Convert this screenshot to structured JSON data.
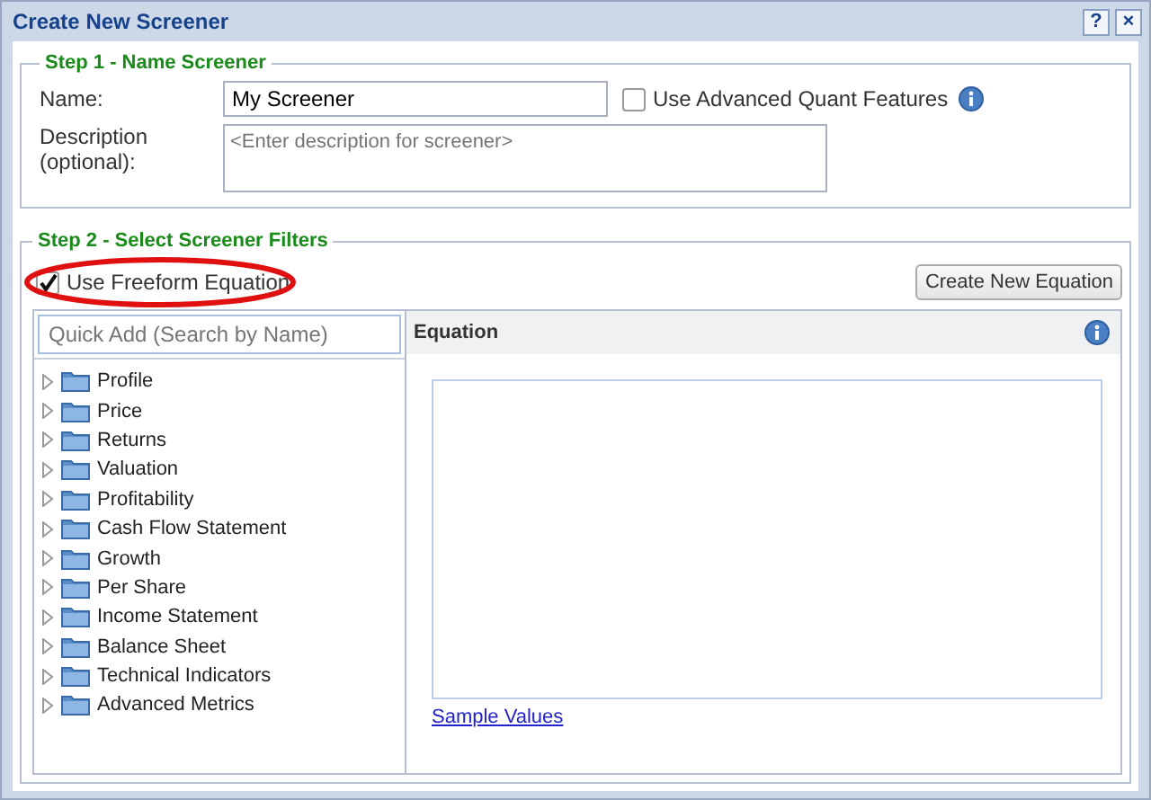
{
  "window": {
    "title": "Create New Screener",
    "help": "?",
    "close": "×"
  },
  "step1": {
    "legend": "Step 1 - Name Screener",
    "name_label": "Name:",
    "name_value": "My Screener",
    "advanced": {
      "label": "Use Advanced Quant Features",
      "checked": false
    },
    "description_label": "Description (optional):",
    "description_placeholder": "<Enter description for screener>"
  },
  "step2": {
    "legend": "Step 2 - Select Screener Filters",
    "freeform": {
      "label": "Use Freeform Equation",
      "checked": true,
      "highlighted": true
    },
    "create_button": "Create New Equation",
    "search_placeholder": "Quick Add (Search by Name)",
    "tree": [
      {
        "label": "Profile",
        "expanded": false
      },
      {
        "label": "Price",
        "expanded": false
      },
      {
        "label": "Returns",
        "expanded": false
      },
      {
        "label": "Valuation",
        "expanded": false
      },
      {
        "label": "Profitability",
        "expanded": false
      },
      {
        "label": "Cash Flow Statement",
        "expanded": false
      },
      {
        "label": "Growth",
        "expanded": false
      },
      {
        "label": "Per Share",
        "expanded": false
      },
      {
        "label": "Income Statement",
        "expanded": false
      },
      {
        "label": "Balance Sheet",
        "expanded": false
      },
      {
        "label": "Technical Indicators",
        "expanded": false
      },
      {
        "label": "Advanced Metrics",
        "expanded": false
      }
    ],
    "equation_header": "Equation",
    "sample_link": "Sample Values"
  }
}
